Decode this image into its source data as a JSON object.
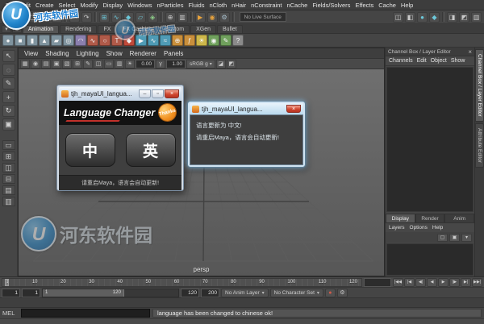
{
  "ui": {
    "caret_down": "▾",
    "close_glyph": "×",
    "minimize_glyph": "–",
    "maximize_glyph": "▫"
  },
  "watermark": {
    "logo_letter": "U",
    "site_name": "河东软件园"
  },
  "menubar": {
    "items": [
      "File",
      "Edit",
      "Create",
      "Select",
      "Modify",
      "Display",
      "Windows",
      "nParticles",
      "Fluids",
      "nCloth",
      "nHair",
      "nConstraint",
      "nCache",
      "Fields/Solvers",
      "Effects",
      "Cache",
      "Help"
    ]
  },
  "statusline": {
    "menuset_glyph": "▦",
    "file_icons": [
      {
        "name": "new-scene-icon",
        "glyph": "▢"
      },
      {
        "name": "open-scene-icon",
        "glyph": "▤"
      },
      {
        "name": "save-scene-icon",
        "glyph": "▣"
      }
    ],
    "undo_icons": [
      {
        "name": "undo-icon",
        "glyph": "↶"
      },
      {
        "name": "redo-icon",
        "glyph": "↷"
      }
    ],
    "snap_icons": [
      {
        "name": "snap-grid-icon",
        "glyph": "⊞",
        "color": "#6cc8da"
      },
      {
        "name": "snap-curve-icon",
        "glyph": "∿",
        "color": "#6cc8da"
      },
      {
        "name": "snap-point-icon",
        "glyph": "◆",
        "color": "#6cc8da"
      },
      {
        "name": "snap-plane-icon",
        "glyph": "▱",
        "color": "#6cc8da"
      },
      {
        "name": "make-live-icon",
        "glyph": "◈",
        "color": "#8fd18a"
      }
    ],
    "history_icons": [
      {
        "name": "construction-history-icon",
        "glyph": "⊕"
      },
      {
        "name": "list-input-operations-icon",
        "glyph": "▥"
      }
    ],
    "render_icons": [
      {
        "name": "render-current-frame-icon",
        "glyph": "▶",
        "color": "#e8a33d"
      },
      {
        "name": "ipr-render-icon",
        "glyph": "◉",
        "color": "#e8a33d"
      },
      {
        "name": "render-settings-icon",
        "glyph": "⚙",
        "color": "#a9c0cd"
      }
    ],
    "no_live_surface": "No Live Surface",
    "right_icons": [
      {
        "name": "symmetry-icon",
        "glyph": "◫"
      },
      {
        "name": "highlight-selection-icon",
        "glyph": "◧"
      },
      {
        "name": "object-mode-icon",
        "glyph": "●",
        "color": "#6cc8da"
      },
      {
        "name": "component-mode-icon",
        "glyph": "◆",
        "color": "#6cc8da"
      }
    ],
    "sidebar_icons": [
      {
        "name": "attribute-editor-toggle-icon",
        "glyph": "◨"
      },
      {
        "name": "tool-settings-toggle-icon",
        "glyph": "◩"
      },
      {
        "name": "channel-box-toggle-icon",
        "glyph": "▥"
      }
    ]
  },
  "shelf": {
    "tabs": [
      "Animation",
      "Rendering",
      "FX",
      "FX Caching",
      "Custom",
      "XGen",
      "Bullet"
    ],
    "icons": [
      {
        "name": "shelf-poly-sphere-icon",
        "glyph": "●",
        "bg": "#7f939e"
      },
      {
        "name": "shelf-poly-cube-icon",
        "glyph": "■",
        "bg": "#7f939e"
      },
      {
        "name": "shelf-poly-cylinder-icon",
        "glyph": "▮",
        "bg": "#7f939e"
      },
      {
        "name": "shelf-poly-cone-icon",
        "glyph": "▲",
        "bg": "#7f939e"
      },
      {
        "name": "shelf-poly-plane-icon",
        "glyph": "▰",
        "bg": "#7f939e"
      },
      {
        "name": "shelf-poly-torus-icon",
        "glyph": "◎",
        "bg": "#7f939e"
      },
      {
        "name": "shelf-sculpt-icon",
        "glyph": "◠",
        "bg": "#8a7fae"
      },
      {
        "name": "shelf-curve-icon",
        "glyph": "∿",
        "bg": "#b05a49"
      },
      {
        "name": "shelf-nurbs-circle-icon",
        "glyph": "○",
        "bg": "#b05a49"
      },
      {
        "name": "shelf-text-icon",
        "glyph": "T",
        "bg": "#b05a49"
      },
      {
        "name": "shelf-set-key-icon",
        "glyph": "◆",
        "bg": "#c04a3a"
      },
      {
        "name": "shelf-playblast-icon",
        "glyph": "▶",
        "bg": "#4f9bb5"
      },
      {
        "name": "shelf-graph-editor-icon",
        "glyph": "∿",
        "bg": "#4f9bb5"
      },
      {
        "name": "shelf-motion-trail-icon",
        "glyph": "≈",
        "bg": "#4f9bb5"
      },
      {
        "name": "shelf-constraint-icon",
        "glyph": "⊕",
        "bg": "#c98f3c"
      },
      {
        "name": "shelf-expression-icon",
        "glyph": "ƒ",
        "bg": "#c98f3c"
      },
      {
        "name": "shelf-light-icon",
        "glyph": "☀",
        "bg": "#cdb74a"
      },
      {
        "name": "shelf-camera-icon",
        "glyph": "◉",
        "bg": "#6fa05c"
      },
      {
        "name": "shelf-paint-icon",
        "glyph": "✎",
        "bg": "#6fa05c"
      },
      {
        "name": "shelf-help-icon",
        "glyph": "?",
        "bg": "#8a8a8a"
      }
    ]
  },
  "toolbox": {
    "tools": [
      {
        "name": "select-tool-icon",
        "glyph": "↖"
      },
      {
        "name": "lasso-tool-icon",
        "glyph": "◌"
      },
      {
        "name": "paint-select-tool-icon",
        "glyph": "✎"
      },
      {
        "name": "move-tool-icon",
        "glyph": "+"
      },
      {
        "name": "rotate-tool-icon",
        "glyph": "↻"
      },
      {
        "name": "scale-tool-icon",
        "glyph": "▣"
      }
    ],
    "layouts": [
      {
        "name": "layout-single-pane-icon",
        "glyph": "▭"
      },
      {
        "name": "layout-four-pane-icon",
        "glyph": "⊞"
      },
      {
        "name": "layout-two-pane-side-icon",
        "glyph": "◫"
      },
      {
        "name": "layout-two-pane-stacked-icon",
        "glyph": "⊟"
      },
      {
        "name": "layout-outliner-persp-icon",
        "glyph": "▤"
      },
      {
        "name": "layout-hypershade-persp-icon",
        "glyph": "▥"
      }
    ]
  },
  "viewport": {
    "menus": [
      "View",
      "Shading",
      "Lighting",
      "Show",
      "Renderer",
      "Panels"
    ],
    "toolbar_icons": [
      {
        "name": "select-camera-icon",
        "glyph": "▦"
      },
      {
        "name": "lock-camera-icon",
        "glyph": "◉"
      },
      {
        "name": "camera-attributes-icon",
        "glyph": "▤"
      },
      {
        "name": "bookmarks-icon",
        "glyph": "▣"
      },
      {
        "name": "image-plane-icon",
        "glyph": "▧"
      },
      {
        "name": "two-d-pan-zoom-icon",
        "glyph": "⊞"
      },
      {
        "name": "grease-pencil-icon",
        "glyph": "✎"
      },
      {
        "name": "film-gate-icon",
        "glyph": "◫"
      },
      {
        "name": "resolution-gate-icon",
        "glyph": "▭"
      },
      {
        "name": "gate-mask-icon",
        "glyph": "▥"
      }
    ],
    "exposure_label": "☀",
    "exposure": "0.00",
    "gamma_label": "γ",
    "gamma": "1.00",
    "colorspace": "sRGB g",
    "extra_icons": [
      {
        "name": "isolate-select-icon",
        "glyph": "◪"
      },
      {
        "name": "xray-icon",
        "glyph": "◩"
      }
    ],
    "camera_label": "persp"
  },
  "dialog1": {
    "title": "tjh_mayaUI_langua...",
    "logo_text": "Language Changer",
    "badge": "Thanks",
    "btn_chinese": "中",
    "btn_english": "英",
    "footer": "请重启Maya，语言会自动更新!"
  },
  "dialog2": {
    "title": "tjh_mayaUI_langua...",
    "line1": "语言更新为 中文!",
    "line2": "请重启Maya，语言会自动更新!"
  },
  "channelbox": {
    "title": "Channel Box / Layer Editor",
    "menus": [
      "Channels",
      "Edit",
      "Object",
      "Show"
    ],
    "layer_tabs": [
      "Display",
      "Render",
      "Anim"
    ],
    "layer_menus": [
      "Layers",
      "Options",
      "Help"
    ],
    "layer_buttons": [
      {
        "name": "new-empty-layer-icon",
        "glyph": "▢"
      },
      {
        "name": "new-layer-from-selected-icon",
        "glyph": "▣"
      },
      {
        "name": "layer-mode-icon",
        "glyph": "▾"
      }
    ]
  },
  "side_tabs": [
    "Channel Box / Layer Editor",
    "Attribute Editor"
  ],
  "timeline": {
    "ticks": [
      "1",
      "10",
      "20",
      "30",
      "40",
      "50",
      "60",
      "70",
      "80",
      "90",
      "100",
      "110",
      "120"
    ]
  },
  "transport": {
    "buttons": [
      {
        "name": "go-to-start-button",
        "glyph": "|◀◀"
      },
      {
        "name": "step-back-frame-button",
        "glyph": "|◀"
      },
      {
        "name": "step-back-key-button",
        "glyph": "◀|"
      },
      {
        "name": "play-backwards-button",
        "glyph": "◀"
      },
      {
        "name": "play-forward-button",
        "glyph": "▶"
      },
      {
        "name": "step-forward-key-button",
        "glyph": "|▶"
      },
      {
        "name": "step-forward-frame-button",
        "glyph": "▶|"
      },
      {
        "name": "go-to-end-button",
        "glyph": "▶▶|"
      }
    ]
  },
  "range": {
    "anim_start": "1",
    "play_start": "1",
    "bar_start": "1",
    "bar_end": "120",
    "play_end": "120",
    "anim_end": "200",
    "anim_layer": "No Anim Layer",
    "character_set": "No Character Set",
    "autokey_glyph": "●",
    "prefs_glyph": "⚙"
  },
  "command": {
    "label": "MEL",
    "input_value": "",
    "result": "language has been changed to chinese ok!"
  }
}
